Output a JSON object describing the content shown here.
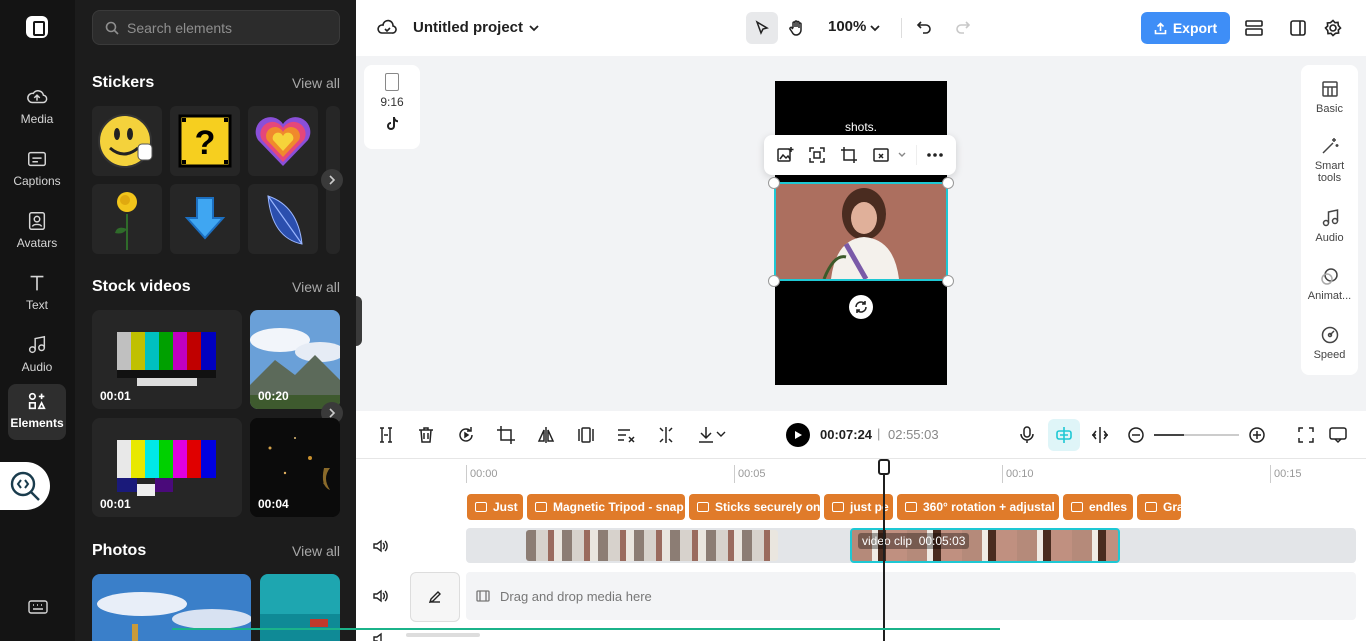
{
  "left_nav": {
    "items": [
      {
        "label": "Media",
        "icon": "cloud-upload-icon"
      },
      {
        "label": "Captions",
        "icon": "captions-icon"
      },
      {
        "label": "Avatars",
        "icon": "avatar-icon"
      },
      {
        "label": "Text",
        "icon": "text-icon"
      },
      {
        "label": "Audio",
        "icon": "music-note-icon"
      },
      {
        "label": "Elements",
        "icon": "elements-icon"
      }
    ],
    "active": "Elements"
  },
  "panel": {
    "search_placeholder": "Search elements",
    "stickers": {
      "title": "Stickers",
      "view_all": "View all"
    },
    "stock_videos": {
      "title": "Stock videos",
      "view_all": "View all",
      "items": [
        {
          "duration": "00:01"
        },
        {
          "duration": "00:20"
        },
        {
          "duration": "00:01"
        },
        {
          "duration": "00:04"
        }
      ]
    },
    "photos": {
      "title": "Photos",
      "view_all": "View all"
    }
  },
  "topbar": {
    "project_title": "Untitled project",
    "zoom": "100%",
    "export_label": "Export"
  },
  "canvas": {
    "aspect_ratio": "9:16",
    "caption_text": "shots."
  },
  "right_bar": {
    "items": [
      {
        "label": "Basic",
        "icon": "basic-icon"
      },
      {
        "label": "Smart tools",
        "icon": "magic-wand-icon"
      },
      {
        "label": "Audio",
        "icon": "music-note-icon"
      },
      {
        "label": "Animat...",
        "icon": "animation-icon"
      },
      {
        "label": "Speed",
        "icon": "speed-icon"
      }
    ]
  },
  "timeline": {
    "current_time": "00:07:24",
    "separator": "|",
    "total_time": "02:55:03",
    "ruler": [
      "00:00",
      "00:05",
      "00:10",
      "00:15"
    ],
    "caption_clips": [
      {
        "text": "Just"
      },
      {
        "text": "Magnetic Tripod - snap"
      },
      {
        "text": "Sticks securely on"
      },
      {
        "text": "just pe"
      },
      {
        "text": "360° rotation + adjustal"
      },
      {
        "text": "endles"
      },
      {
        "text": "Gra"
      }
    ],
    "video_clip": {
      "label": "video clip",
      "duration": "00:05:03"
    },
    "drop_hint": "Drag and drop media here"
  },
  "colors": {
    "accent": "#3e8ef7",
    "selection": "#1ec8d4",
    "caption_clip": "#e07b2a",
    "sidebar_bg": "#141414",
    "panel_bg": "#1c1c1c"
  }
}
